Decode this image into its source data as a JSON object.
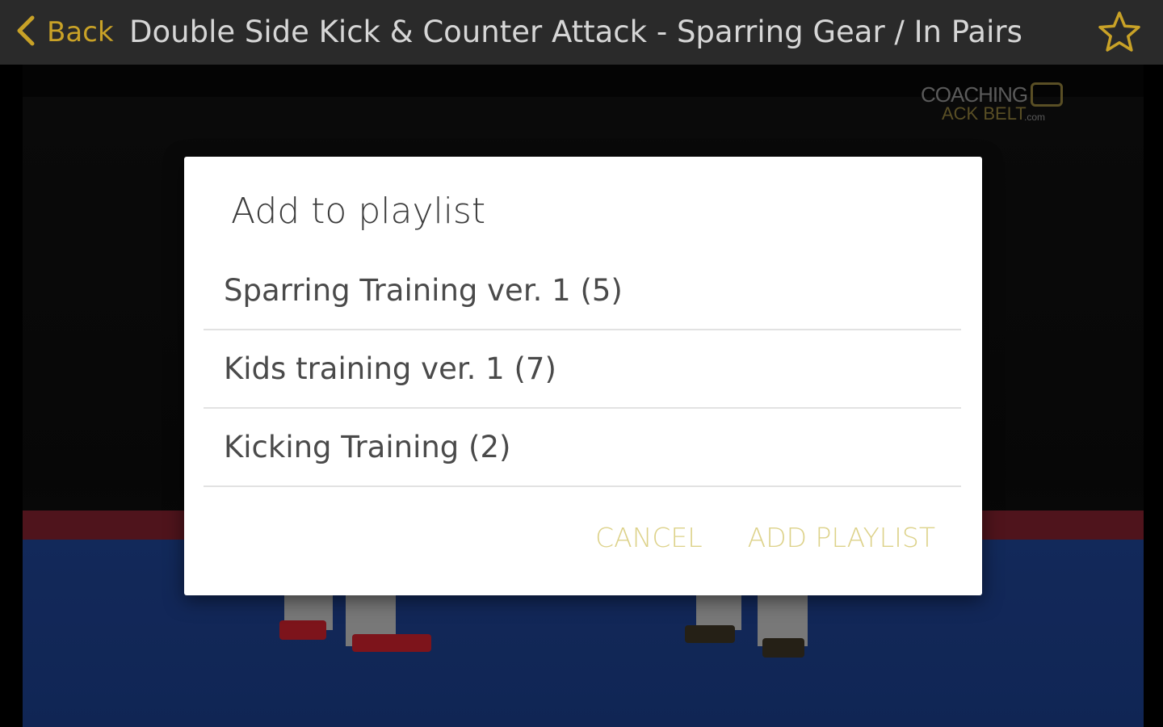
{
  "header": {
    "back_label": "Back",
    "title": "Double Side Kick & Counter Attack - Sparring Gear / In Pairs",
    "back_icon": "chevron-left-icon",
    "favorite_icon": "star-outline-icon",
    "accent_color": "#c9a227"
  },
  "video": {
    "logo_line1": "COACHING",
    "logo_line2": "ACK BELT",
    "logo_domain": ".com"
  },
  "dialog": {
    "title": "Add to playlist",
    "playlists": [
      {
        "label": "Sparring Training ver. 1 (5)"
      },
      {
        "label": "Kids training ver. 1 (7)"
      },
      {
        "label": "Kicking Training (2)"
      }
    ],
    "cancel_label": "CANCEL",
    "add_playlist_label": "ADD PLAYLIST",
    "button_color": "#ddd28a"
  }
}
